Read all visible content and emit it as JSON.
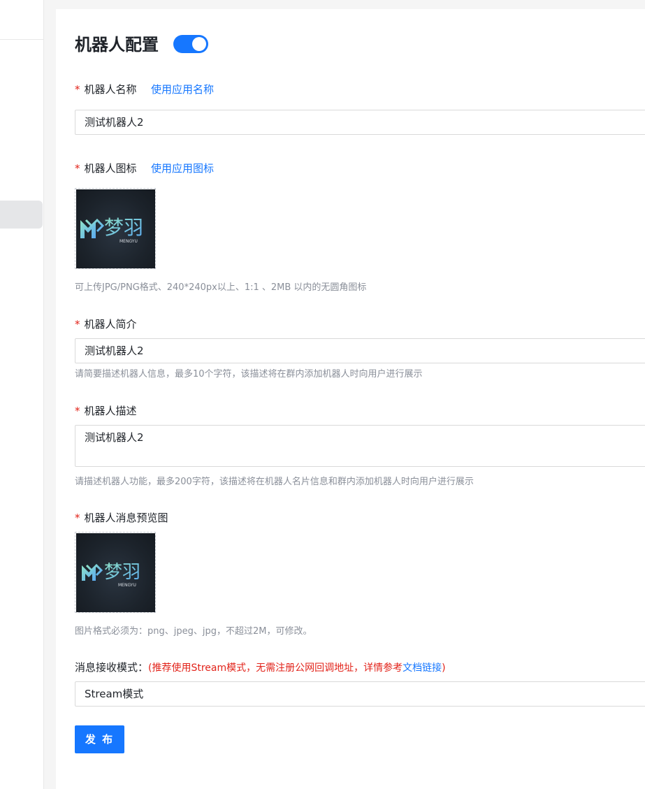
{
  "config": {
    "title": "机器人配置",
    "enabled": true
  },
  "fields": {
    "name": {
      "required_mark": "*",
      "label": "机器人名称",
      "link": "使用应用名称",
      "value": "测试机器人2"
    },
    "icon": {
      "required_mark": "*",
      "label": "机器人图标",
      "link": "使用应用图标",
      "logo_text": "梦羽",
      "logo_sub": "MENGYU",
      "hint": "可上传JPG/PNG格式、240*240px以上、1:1 、2MB 以内的无圆角图标"
    },
    "intro": {
      "required_mark": "*",
      "label": "机器人简介",
      "value": "测试机器人2",
      "hint": "请简要描述机器人信息，最多10个字符，该描述将在群内添加机器人时向用户进行展示"
    },
    "description": {
      "required_mark": "*",
      "label": "机器人描述",
      "value": "测试机器人2",
      "hint": "请描述机器人功能，最多200字符，该描述将在机器人名片信息和群内添加机器人时向用户进行展示"
    },
    "preview": {
      "required_mark": "*",
      "label": "机器人消息预览图",
      "logo_text": "梦羽",
      "logo_sub": "MENGYU",
      "hint": "图片格式必须为：png、jpeg、jpg，不超过2M，可修改。"
    },
    "receive_mode": {
      "label": "消息接收模式：",
      "note_prefix": "(推荐使用Stream模式，无需注册公网回调地址，详情参考",
      "note_link": "文档链接",
      "note_suffix": ")",
      "value": "Stream模式"
    }
  },
  "actions": {
    "publish_label": "发 布"
  },
  "colors": {
    "primary": "#1677ff",
    "required": "#e2231a",
    "logo_gradient_start": "#8fe3c9",
    "logo_gradient_end": "#5aa9f0"
  }
}
